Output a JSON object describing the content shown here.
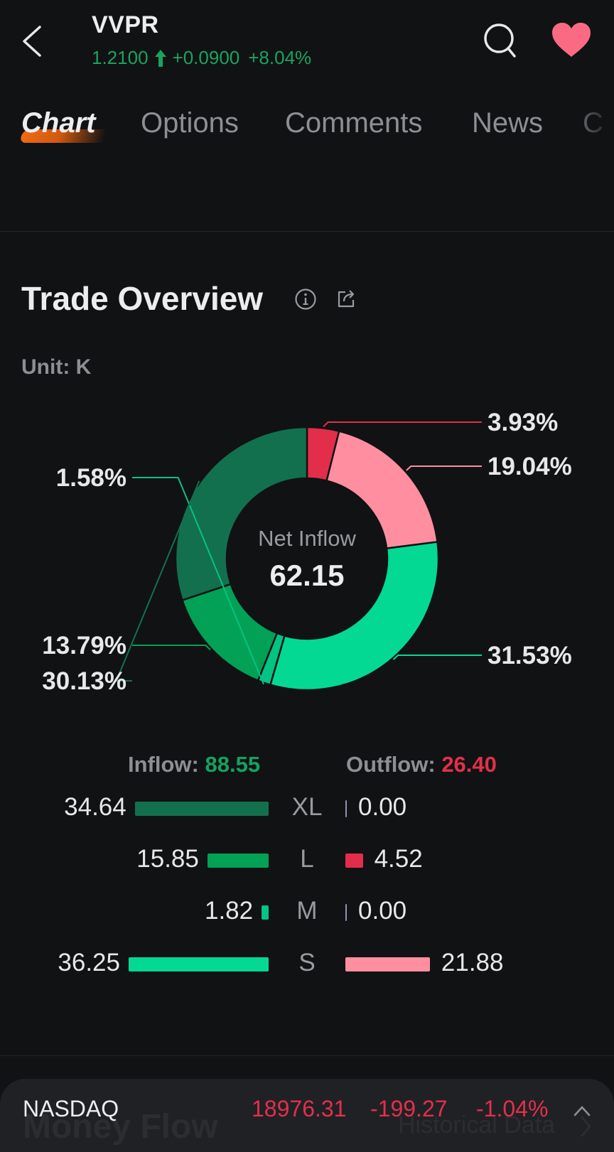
{
  "header": {
    "ticker": "VVPR",
    "price": "1.2100",
    "change": "+0.0900",
    "change_pct": "+8.04%",
    "price_direction": "up",
    "up_color": "#1aa35f",
    "favorite_color": "#fb6a83",
    "icons": {
      "back": "chevron-left-icon",
      "search": "search-icon",
      "favorite": "heart-icon"
    }
  },
  "tabs": [
    {
      "label": "Chart",
      "active": true
    },
    {
      "label": "Options",
      "active": false
    },
    {
      "label": "Comments",
      "active": false
    },
    {
      "label": "News",
      "active": false
    },
    {
      "label": "C",
      "active": false
    }
  ],
  "section": {
    "title": "Trade Overview",
    "unit": "Unit: K",
    "icons": {
      "info": "info-icon",
      "share": "share-icon"
    }
  },
  "chart_data": {
    "type": "pie",
    "variant": "donut",
    "title": "Trade Overview",
    "unit": "K",
    "center_label": "Net Inflow",
    "center_value": "62.15",
    "start_angle": "12 o'clock",
    "direction": "clockwise",
    "slices": [
      {
        "name": "L Outflow",
        "value": 3.93,
        "label": "3.93%",
        "color": "#e22e4a",
        "label_side": "right"
      },
      {
        "name": "S Outflow",
        "value": 19.04,
        "label": "19.04%",
        "color": "#ff8fa0",
        "label_side": "right"
      },
      {
        "name": "S Inflow",
        "value": 31.53,
        "label": "31.53%",
        "color": "#03d993",
        "label_side": "right"
      },
      {
        "name": "M Inflow",
        "value": 1.58,
        "label": "1.58%",
        "color": "#03c482",
        "label_side": "left"
      },
      {
        "name": "L Inflow",
        "value": 13.79,
        "label": "13.79%",
        "color": "#02a155",
        "label_side": "left"
      },
      {
        "name": "XL Inflow",
        "value": 30.13,
        "label": "30.13%",
        "color": "#13704f",
        "label_side": "left"
      }
    ],
    "totals": {
      "inflow_label": "Inflow:",
      "inflow_value": "88.55",
      "outflow_label": "Outflow:",
      "outflow_value": "26.40"
    },
    "flow_breakdown": {
      "type": "bar",
      "categories": [
        "XL",
        "L",
        "M",
        "S"
      ],
      "series": [
        {
          "name": "Inflow",
          "values": [
            34.64,
            15.85,
            1.82,
            36.25
          ],
          "labels": [
            "34.64",
            "15.85",
            "1.82",
            "36.25"
          ],
          "colors": [
            "#13704f",
            "#02a155",
            "#03c482",
            "#03d993"
          ]
        },
        {
          "name": "Outflow",
          "values": [
            0.0,
            4.52,
            0.0,
            21.88
          ],
          "labels": [
            "0.00",
            "4.52",
            "0.00",
            "21.88"
          ],
          "colors": [
            "#8c93b8",
            "#e22e4a",
            "#8c93b8",
            "#ff8fa0"
          ]
        }
      ],
      "scale_max": 36.25
    }
  },
  "ticker_bar": {
    "name": "NASDAQ",
    "price": "18976.31",
    "change": "-199.27",
    "change_pct": "-1.04%",
    "down_color": "#e2304a",
    "behind_title": "Money Flow",
    "behind_link": "Historical Data"
  }
}
